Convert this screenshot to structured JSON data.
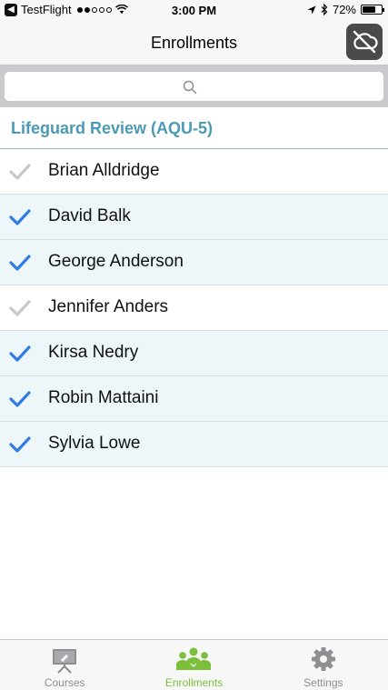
{
  "status_bar": {
    "carrier": "TestFlight",
    "time": "3:00 PM",
    "battery": "72%",
    "battery_level": 0.72
  },
  "nav": {
    "title": "Enrollments",
    "action_icon": "cloud-off-icon"
  },
  "search": {
    "placeholder": "",
    "icon": "search-icon"
  },
  "section": {
    "title": "Lifeguard Review  (AQU-5)"
  },
  "enrollments": [
    {
      "name": "Brian Alldridge",
      "checked": false
    },
    {
      "name": "David Balk",
      "checked": true
    },
    {
      "name": "George Anderson",
      "checked": true
    },
    {
      "name": "Jennifer Anders",
      "checked": false
    },
    {
      "name": "Kirsa Nedry",
      "checked": true
    },
    {
      "name": "Robin Mattaini",
      "checked": true
    },
    {
      "name": "Sylvia Lowe",
      "checked": true
    }
  ],
  "tabs": [
    {
      "label": "Courses",
      "icon": "easel-icon",
      "active": false
    },
    {
      "label": "Enrollments",
      "icon": "group-icon",
      "active": true
    },
    {
      "label": "Settings",
      "icon": "gear-icon",
      "active": false
    }
  ],
  "colors": {
    "accent": "#4a9ab4",
    "check_active": "#2f7de1",
    "check_inactive": "#c8c8c8",
    "tab_active": "#7bbf3a",
    "row_checked_bg": "#edf6f8"
  }
}
